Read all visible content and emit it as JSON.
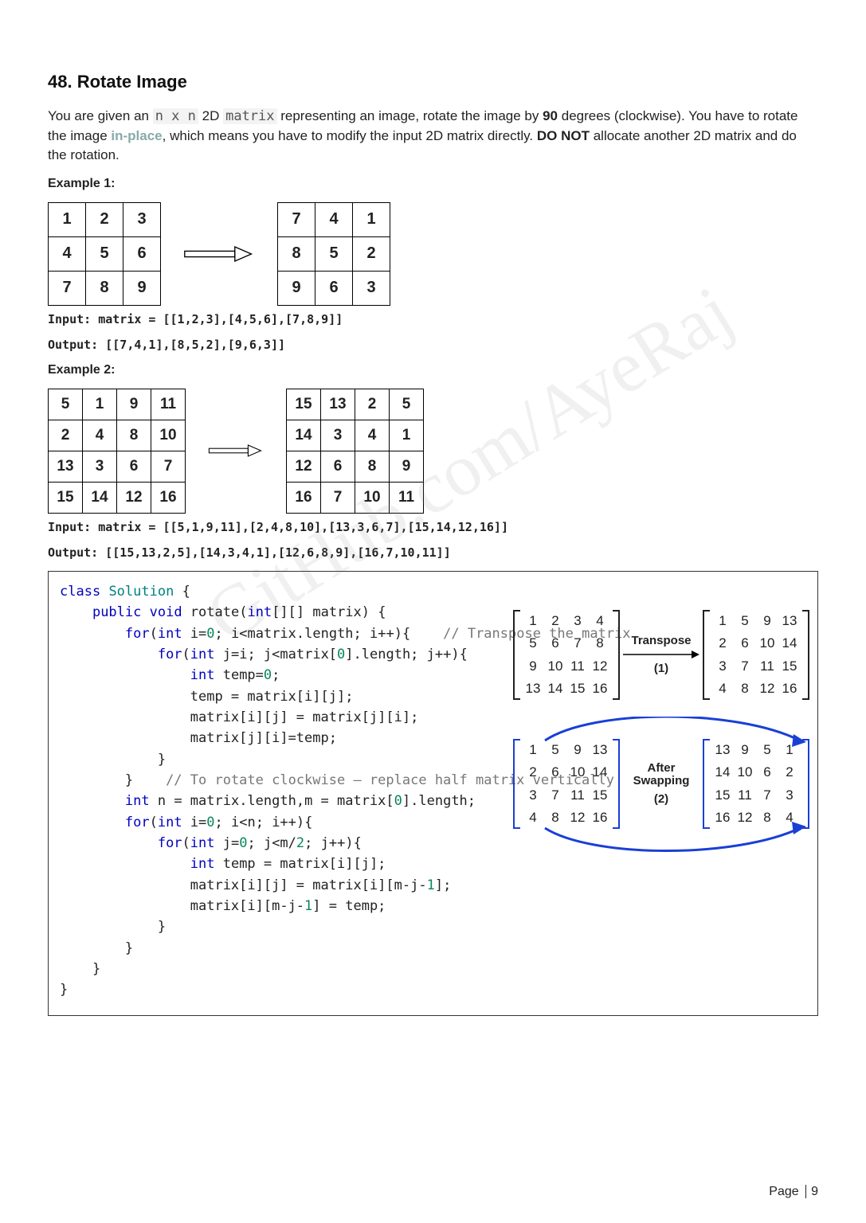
{
  "title": "48. Rotate Image",
  "desc": {
    "line1_pre": "You are given an ",
    "code_nxn": "n x n",
    "line1_mid": " 2D ",
    "code_matrix": "matrix",
    "line1_post": " representing an image, rotate the image by ",
    "ninety": "90",
    "line1_end": " degrees (clockwise).",
    "line2_pre": "You have to rotate the image ",
    "inplace": "in-place",
    "line2_mid": ", which means you have to modify the input 2D matrix directly. ",
    "donot": "DO NOT",
    "line2_end": " allocate another 2D matrix and do the rotation."
  },
  "ex1": {
    "label": "Example 1:",
    "before": [
      [
        "1",
        "2",
        "3"
      ],
      [
        "4",
        "5",
        "6"
      ],
      [
        "7",
        "8",
        "9"
      ]
    ],
    "after": [
      [
        "7",
        "4",
        "1"
      ],
      [
        "8",
        "5",
        "2"
      ],
      [
        "9",
        "6",
        "3"
      ]
    ],
    "input": "Input: matrix = [[1,2,3],[4,5,6],[7,8,9]]",
    "output": "Output: [[7,4,1],[8,5,2],[9,6,3]]"
  },
  "ex2": {
    "label": "Example 2:",
    "before": [
      [
        "5",
        "1",
        "9",
        "11"
      ],
      [
        "2",
        "4",
        "8",
        "10"
      ],
      [
        "13",
        "3",
        "6",
        "7"
      ],
      [
        "15",
        "14",
        "12",
        "16"
      ]
    ],
    "after": [
      [
        "15",
        "13",
        "2",
        "5"
      ],
      [
        "14",
        "3",
        "4",
        "1"
      ],
      [
        "12",
        "6",
        "8",
        "9"
      ],
      [
        "16",
        "7",
        "10",
        "11"
      ]
    ],
    "input": "Input: matrix = [[5,1,9,11],[2,4,8,10],[13,3,6,7],[15,14,12,16]]",
    "output": "Output: [[15,13,2,5],[14,3,4,1],[12,6,8,9],[16,7,10,11]]"
  },
  "code": "class Solution {\n    public void rotate(int[][] matrix) {\n        for(int i=0; i<matrix.length; i++){    // Transpose the matrix\n            for(int j=i; j<matrix[0].length; j++){\n                int temp=0;\n                temp = matrix[i][j];\n                matrix[i][j] = matrix[j][i];\n                matrix[j][i]=temp;\n            }\n        }    // To rotate clockwise – replace half matrix vertically\n        int n = matrix.length,m = matrix[0].length;\n        for(int i=0; i<n; i++){\n            for(int j=0; j<m/2; j++){\n                int temp = matrix[i][j];\n                matrix[i][j] = matrix[i][m-j-1];\n                matrix[i][m-j-1] = temp;\n            }\n        }\n    }\n}",
  "diagrams": {
    "transpose": {
      "label1": "Transpose",
      "step": "(1)",
      "left": [
        [
          "1",
          "2",
          "3",
          "4"
        ],
        [
          "5",
          "6",
          "7",
          "8"
        ],
        [
          "9",
          "10",
          "11",
          "12"
        ],
        [
          "13",
          "14",
          "15",
          "16"
        ]
      ],
      "right": [
        [
          "1",
          "5",
          "9",
          "13"
        ],
        [
          "2",
          "6",
          "10",
          "14"
        ],
        [
          "3",
          "7",
          "11",
          "15"
        ],
        [
          "4",
          "8",
          "12",
          "16"
        ]
      ]
    },
    "swap": {
      "label1": "After",
      "label2": "Swapping",
      "step": "(2)",
      "left": [
        [
          "1",
          "5",
          "9",
          "13"
        ],
        [
          "2",
          "6",
          "10",
          "14"
        ],
        [
          "3",
          "7",
          "11",
          "15"
        ],
        [
          "4",
          "8",
          "12",
          "16"
        ]
      ],
      "right": [
        [
          "13",
          "9",
          "5",
          "1"
        ],
        [
          "14",
          "10",
          "6",
          "2"
        ],
        [
          "15",
          "11",
          "7",
          "3"
        ],
        [
          "16",
          "12",
          "8",
          "4"
        ]
      ]
    }
  },
  "watermark": "GitHub.com/AyeRaj",
  "footer": {
    "prefix": "Page ",
    "num": "9"
  }
}
